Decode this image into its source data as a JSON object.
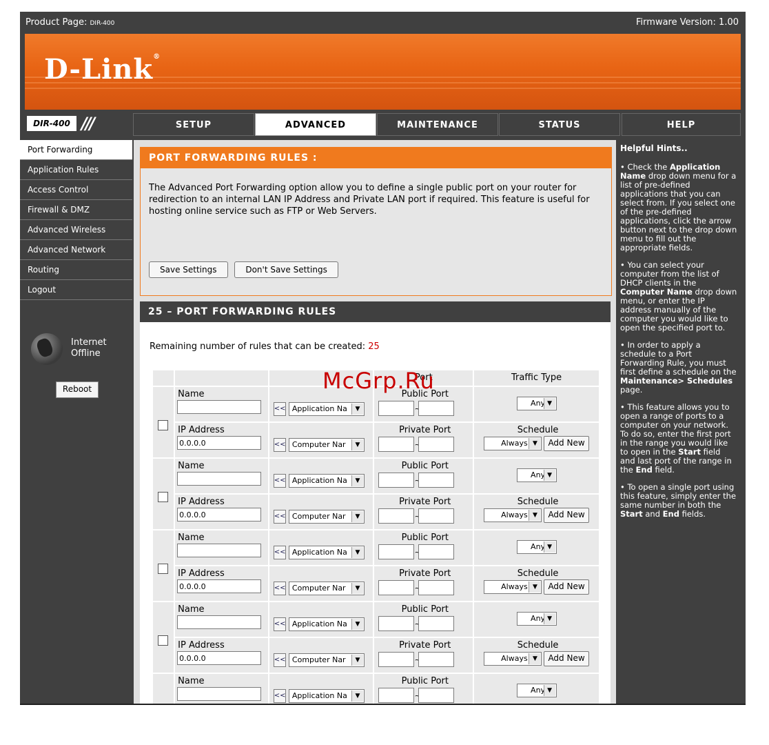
{
  "topbar": {
    "product_label": "Product Page:",
    "product_model": "DIR-400",
    "firmware": "Firmware Version: 1.00"
  },
  "brand": {
    "logo": "D-Link",
    "reg": "®",
    "model_badge": "DIR-400",
    "slashes": "///"
  },
  "tabs": [
    {
      "label": "SETUP",
      "active": false
    },
    {
      "label": "ADVANCED",
      "active": true
    },
    {
      "label": "MAINTENANCE",
      "active": false
    },
    {
      "label": "STATUS",
      "active": false
    },
    {
      "label": "HELP",
      "active": false
    }
  ],
  "sidebar": {
    "items": [
      {
        "label": "Port Forwarding",
        "active": true
      },
      {
        "label": "Application Rules"
      },
      {
        "label": "Access Control"
      },
      {
        "label": "Firewall & DMZ"
      },
      {
        "label": "Advanced Wireless"
      },
      {
        "label": "Advanced Network"
      },
      {
        "label": "Routing"
      },
      {
        "label": "Logout"
      }
    ],
    "status_line1": "Internet",
    "status_line2": "Offline",
    "reboot_label": "Reboot"
  },
  "intro": {
    "title": "PORT FORWARDING RULES :",
    "description": "The Advanced Port Forwarding option allow you to define a single public port on your router for redirection to an internal LAN IP Address and Private LAN port if required. This feature is useful for hosting online service such as FTP or Web Servers.",
    "save_label": "Save Settings",
    "dont_save_label": "Don't Save Settings"
  },
  "rules": {
    "title": "25 – PORT FORWARDING RULES",
    "remaining_label": "Remaining number of rules that can be created:",
    "remaining_count": "25",
    "header_port": "Port",
    "header_traffic": "Traffic Type",
    "labels": {
      "name": "Name",
      "ip": "IP Address",
      "public_port": "Public Port",
      "private_port": "Private Port",
      "schedule": "Schedule",
      "arrow": "<<",
      "app_select": "Application Na",
      "comp_select": "Computer Nar",
      "traffic_value": "Any",
      "schedule_value": "Always",
      "add_new": "Add New",
      "ip_value": "0.0.0.0",
      "tilde": "~"
    }
  },
  "watermark": "McGrp.Ru",
  "hints": {
    "title": "Helpful Hints..",
    "p1_a": "• Check the ",
    "p1_b": "Application Name",
    "p1_c": " drop down menu for a list of pre-defined applications that you can select from. If you select one of the pre-defined applications, click the arrow button next to the drop down menu to fill out the appropriate fields.",
    "p2_a": "• You can select your computer from the list of DHCP clients in the ",
    "p2_b": "Computer Name",
    "p2_c": " drop down menu, or enter the IP address manually of the computer you would like to open the specified port to.",
    "p3_a": "• In order to apply a schedule to a Port Forwarding Rule, you must first define a schedule on the ",
    "p3_b": "Maintenance> Schedules",
    "p3_c": " page.",
    "p4_a": "• This feature allows you to open a range of ports to a computer on your network. To do so, enter the first port in the range you would like to open in the ",
    "p4_b": "Start",
    "p4_c": " field and last port of the range in the ",
    "p4_d": "End",
    "p4_e": " field.",
    "p5_a": "• To open a single port using this feature, simply enter the same number in both the ",
    "p5_b": "Start",
    "p5_c": " and ",
    "p5_d": "End",
    "p5_e": " fields."
  },
  "colors": {
    "accent": "#f07a1e",
    "dark": "#404040",
    "remaining": "#cc0000",
    "watermark": "#c80000"
  }
}
